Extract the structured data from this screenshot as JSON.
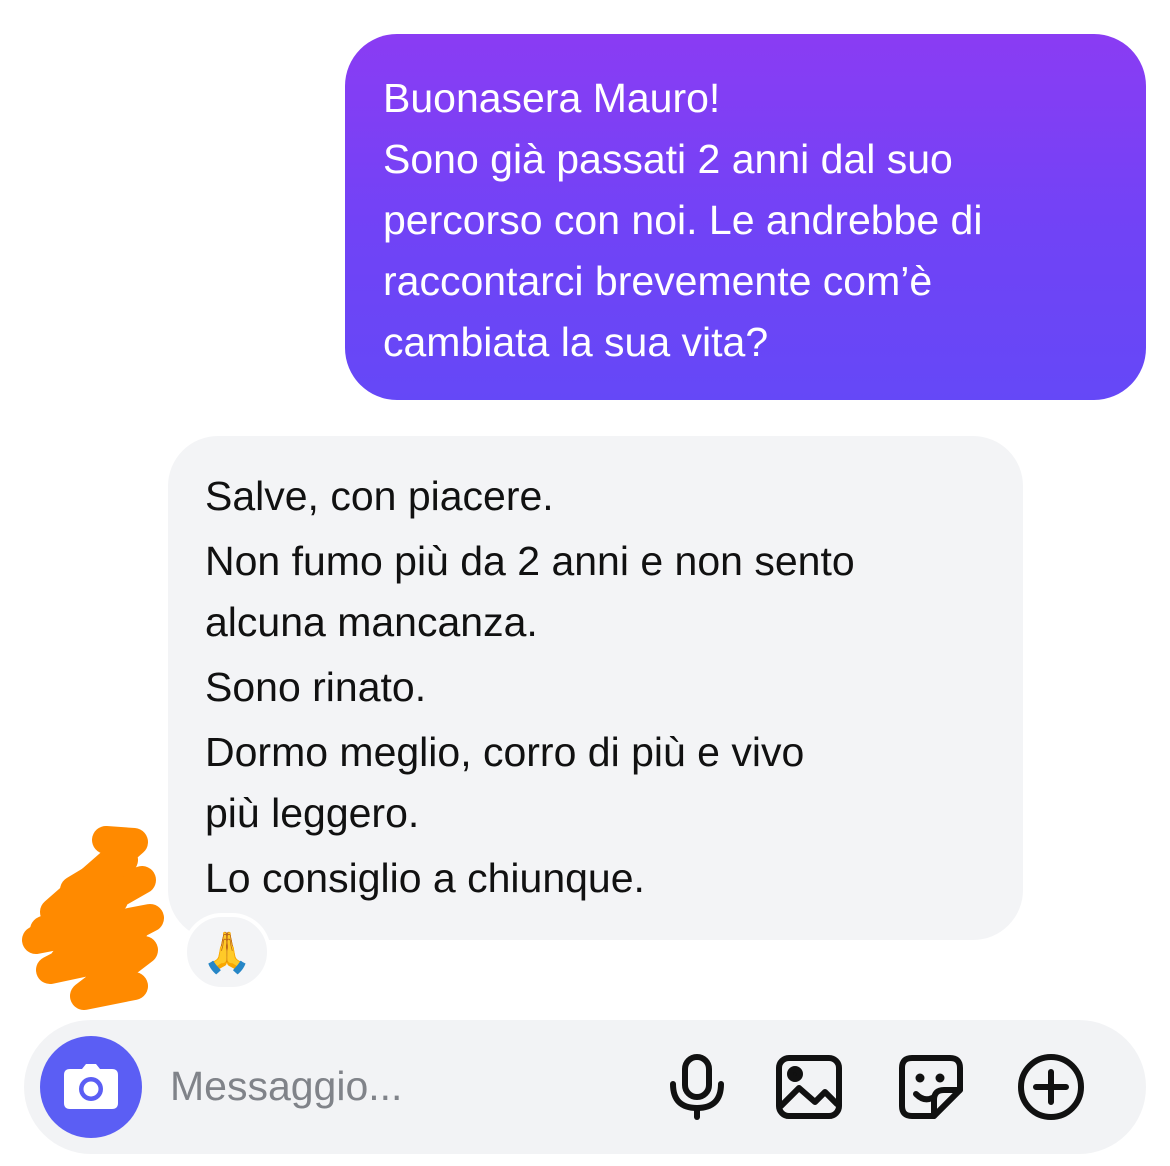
{
  "outgoing_message": {
    "lines": [
      "Buonasera Mauro!",
      "Sono già passati 2 anni dal suo",
      "percorso con noi. Le andrebbe di",
      "raccontarci brevemente com’è",
      "cambiata la sua vita?"
    ],
    "colors": {
      "top": "#8a3cf3",
      "bottom": "#6548f7",
      "text": "#ffffff"
    }
  },
  "incoming_message": {
    "lines": [
      "Salve, con piacere.",
      "Non fumo più da 2 anni e non sento",
      "alcuna mancanza.",
      "Sono rinato.",
      "Dormo meglio, corro di più e vivo",
      "più leggero.",
      "Lo consiglio a chiunque."
    ],
    "reaction": "🙏",
    "colors": {
      "background": "#f3f4f6",
      "text": "#111111"
    }
  },
  "redaction": {
    "color": "#ff8a00",
    "icon": "scribble-redaction"
  },
  "composer": {
    "placeholder": "Messaggio...",
    "camera_icon": "camera-icon",
    "tools": [
      "microphone-icon",
      "image-icon",
      "sticker-icon",
      "add-circle-icon"
    ],
    "accent": "#5b5ef4"
  }
}
